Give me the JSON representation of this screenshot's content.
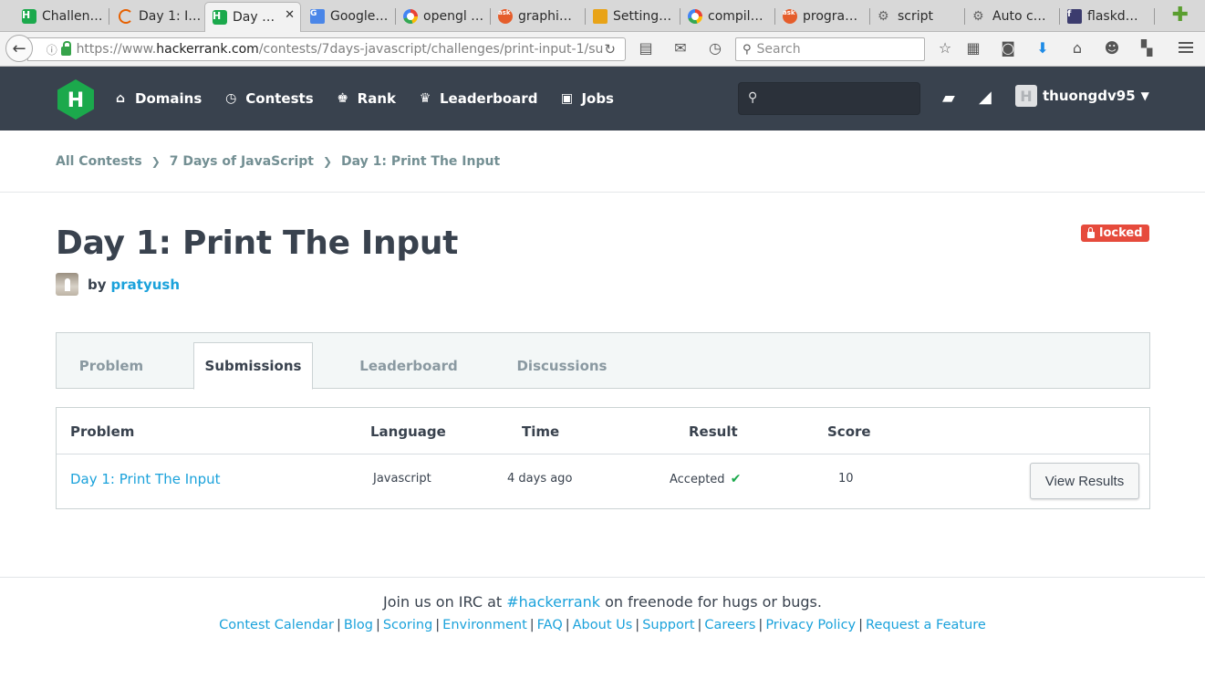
{
  "browser": {
    "tabs": [
      {
        "title": "Challen…",
        "icon": "hackerrank-icon"
      },
      {
        "title": "Day 1: I…",
        "icon": "loading-spinner-icon"
      },
      {
        "title": "Day …",
        "icon": "hackerrank-icon",
        "active": true
      },
      {
        "title": "Google…",
        "icon": "google-translate-icon"
      },
      {
        "title": "opengl …",
        "icon": "google-icon"
      },
      {
        "title": "graphi…",
        "icon": "askubuntu-icon"
      },
      {
        "title": "Setting…",
        "icon": "settings-icon"
      },
      {
        "title": "compil…",
        "icon": "google-icon"
      },
      {
        "title": "progra…",
        "icon": "askubuntu-icon"
      },
      {
        "title": "script",
        "icon": "gear-icon"
      },
      {
        "title": "Auto c…",
        "icon": "gear-icon"
      },
      {
        "title": "flaskd…",
        "icon": "flask-icon"
      }
    ],
    "url": {
      "scheme": "https://www.",
      "host": "hackerrank.com",
      "path": "/contests/7days-javascript/challenges/print-input-1/su"
    },
    "search_placeholder": "Search",
    "tab_close": "✕",
    "new_tab": "✚"
  },
  "hr": {
    "nav": [
      {
        "label": "Domains",
        "icon": "home-icon"
      },
      {
        "label": "Contests",
        "icon": "clock-icon"
      },
      {
        "label": "Rank",
        "icon": "medal-icon"
      },
      {
        "label": "Leaderboard",
        "icon": "trophy-icon"
      },
      {
        "label": "Jobs",
        "icon": "briefcase-icon"
      }
    ],
    "username": "thuongdv95",
    "avatar_letter": "H",
    "logo_letter": "H"
  },
  "breadcrumb": [
    "All Contests",
    "7 Days of JavaScript",
    "Day 1: Print The Input"
  ],
  "challenge": {
    "title": "Day 1: Print The Input",
    "status_badge": "locked",
    "by_label": "by",
    "author": "pratyush"
  },
  "content_tabs": [
    "Problem",
    "Submissions",
    "Leaderboard",
    "Discussions"
  ],
  "active_tab": "Submissions",
  "table": {
    "headers": [
      "Problem",
      "Language",
      "Time",
      "Result",
      "Score"
    ],
    "rows": [
      {
        "problem": "Day 1: Print The Input",
        "language": "Javascript",
        "time": "4 days ago",
        "result": "Accepted",
        "score": "10",
        "action": "View Results"
      }
    ]
  },
  "footer": {
    "irc_before": "Join us on IRC at ",
    "irc_channel": "#hackerrank",
    "irc_after": " on freenode for hugs or bugs.",
    "links": [
      "Contest Calendar",
      "Blog",
      "Scoring",
      "Environment",
      "FAQ",
      "About Us",
      "Support",
      "Careers",
      "Privacy Policy",
      "Request a Feature"
    ]
  },
  "colors": {
    "header_bg": "#39424e",
    "brand_green": "#1ba94c",
    "link_blue": "#1ba2db",
    "locked_red": "#e64b3c"
  }
}
